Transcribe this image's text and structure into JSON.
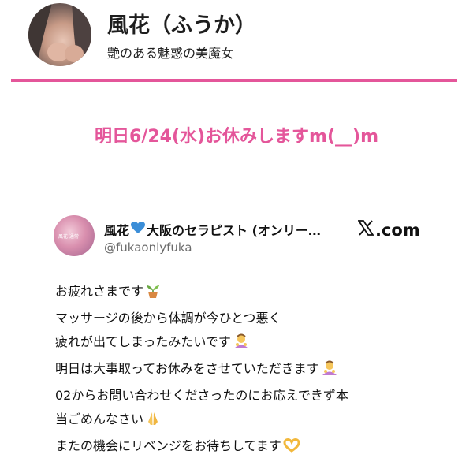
{
  "profile": {
    "name": "風花（ふうか）",
    "tagline": "艶のある魅惑の美魔女"
  },
  "notice": "明日6/24(水)お休みしますm(__)m",
  "post": {
    "author_name": "風花",
    "author_suffix": "大阪のセラピスト (オンリー…",
    "handle": "@fukaonlyfuka",
    "site": ".com",
    "avatar_caption": "風花 通常",
    "lines": [
      {
        "text": "お疲れさまです",
        "emoji": "plant-icon"
      },
      {
        "text": "マッサージの後から体調が今ひとつ悪く",
        "emoji": ""
      },
      {
        "text": "疲れが出てしまったみたいです",
        "emoji": "bowing-icon"
      },
      {
        "text": "明日は大事取ってお休みをさせていただきます",
        "emoji": "bowing-icon"
      },
      {
        "text": "02からお問い合わせくださったのにお応えできず本",
        "emoji": ""
      },
      {
        "text": "当ごめんなさい",
        "emoji": "pray-icon"
      },
      {
        "text": "またの機会にリベンジをお待ちしてます",
        "emoji": "heart-hands-icon"
      }
    ]
  },
  "colors": {
    "accent": "#e4569a",
    "text": "#111111",
    "muted": "#6b6b6b",
    "heart": "#3b8ed8"
  }
}
